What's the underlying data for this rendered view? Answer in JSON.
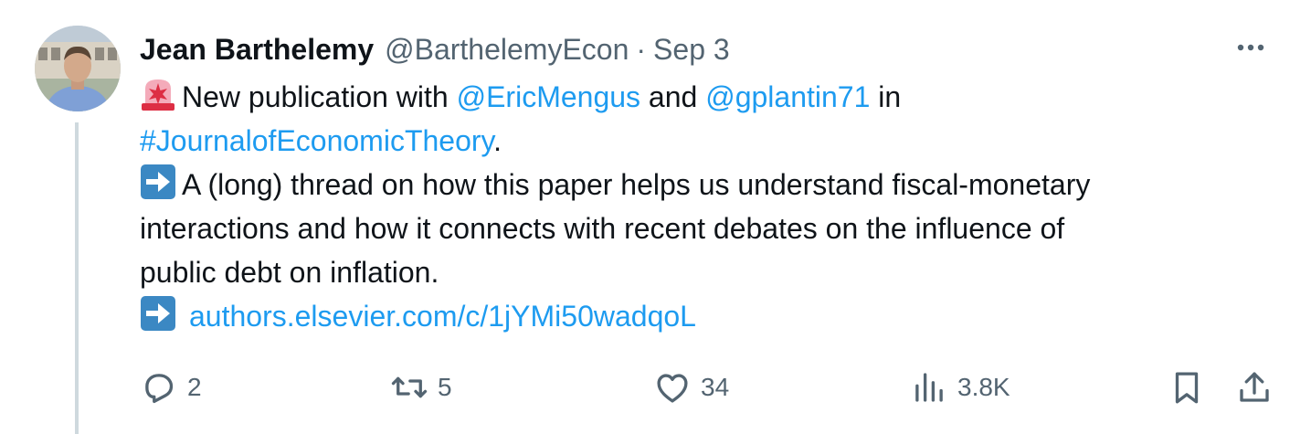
{
  "tweet": {
    "author_name": "Jean Barthelemy",
    "handle": "@BarthelemyEcon",
    "separator": "·",
    "date": "Sep 3",
    "line1_text": "New publication with ",
    "mention1": "@EricMengus",
    "and_text": " and ",
    "mention2": "@gplantin71",
    "in_text": " in",
    "hashtag": "#JournalofEconomicTheory",
    "period": ".",
    "thread_line1": "A (long) thread on how this paper helps us understand fiscal-monetary",
    "thread_line2": "interactions and how it connects with recent debates on the influence of",
    "thread_line3": "public debt on inflation.",
    "link": "authors.elsevier.com/c/1jYMi50wadqoL"
  },
  "actions": {
    "replies": "2",
    "reposts": "5",
    "likes": "34",
    "views": "3.8K"
  },
  "icons": [
    "siren-emoji-icon",
    "right-arrow-emoji-icon",
    "more-icon",
    "reply-icon",
    "repost-icon",
    "like-icon",
    "views-icon",
    "bookmark-icon",
    "share-icon"
  ],
  "colors": {
    "link": "#1d9bf0",
    "muted": "#536471",
    "text": "#0f1419",
    "thread_line": "#cfd9de",
    "emoji_blue": "#3b88c3",
    "emoji_red": "#dd2e44"
  }
}
